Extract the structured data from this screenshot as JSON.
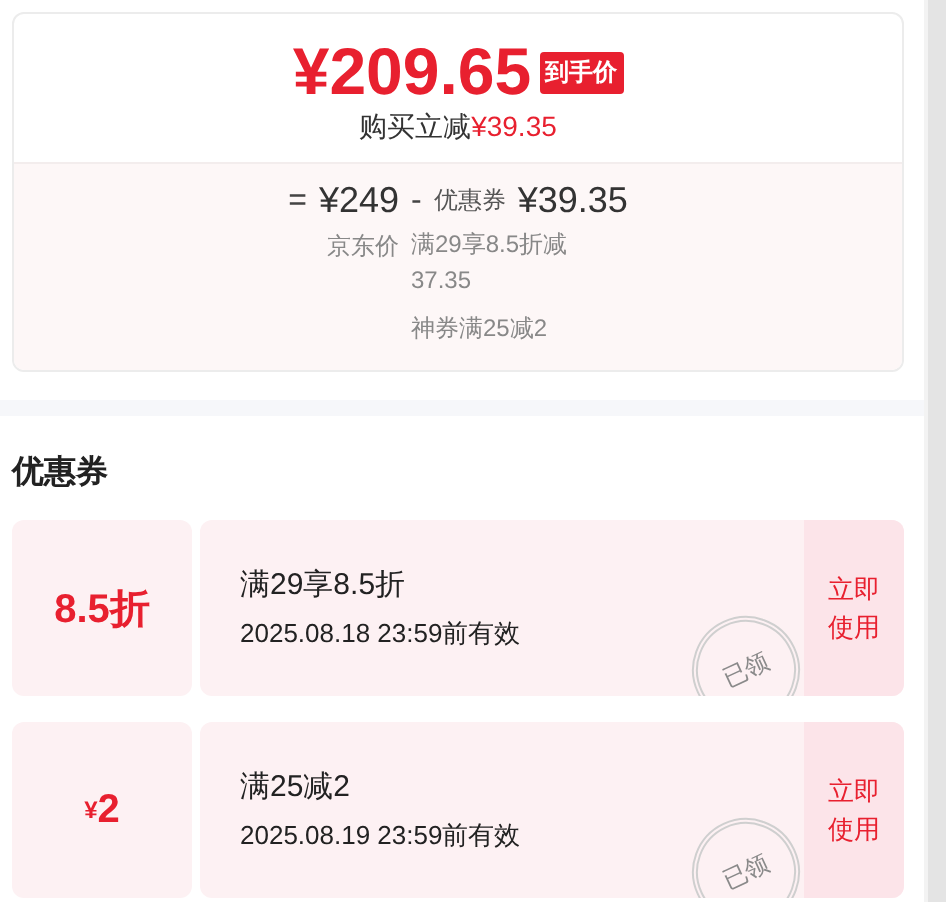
{
  "price_card": {
    "final_price": "¥209.65",
    "final_badge": "到手价",
    "saving_label": "购买立减",
    "saving_amount": "¥39.35",
    "breakdown": {
      "equals": "=",
      "base_price": "¥249",
      "base_label": "京东价",
      "minus": "-",
      "coupon_label": "优惠券",
      "coupon_amount": "¥39.35",
      "details": [
        "满29享8.5折减37.35",
        "神券满25减2"
      ]
    }
  },
  "coupon_section": {
    "title": "优惠券",
    "coupons": [
      {
        "kind": "discount",
        "amount": "8.5折",
        "condition": "满29享8.5折",
        "validity": "2025.08.18 23:59前有效",
        "stamp": "已领",
        "action": "立即使用"
      },
      {
        "kind": "cash",
        "currency": "¥",
        "amount": "2",
        "condition": "满25减2",
        "validity": "2025.08.19 23:59前有效",
        "stamp": "已领",
        "action": "立即使用"
      }
    ]
  }
}
